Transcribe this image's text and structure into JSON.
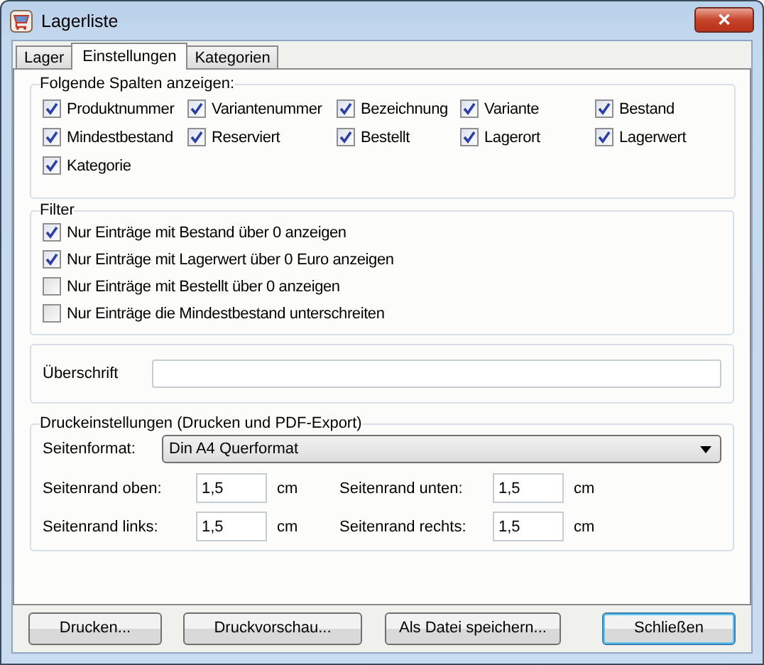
{
  "window": {
    "title": "Lagerliste",
    "close_label": "✕"
  },
  "tabs": [
    {
      "label": "Lager",
      "selected": false
    },
    {
      "label": "Einstellungen",
      "selected": true
    },
    {
      "label": "Kategorien",
      "selected": false
    }
  ],
  "columns_group": {
    "title": "Folgende Spalten anzeigen:",
    "items": [
      {
        "label": "Produktnummer",
        "checked": true
      },
      {
        "label": "Variantenummer",
        "checked": true
      },
      {
        "label": "Bezeichnung",
        "checked": true
      },
      {
        "label": "Variante",
        "checked": true
      },
      {
        "label": "Bestand",
        "checked": true
      },
      {
        "label": "Mindestbestand",
        "checked": true
      },
      {
        "label": "Reserviert",
        "checked": true
      },
      {
        "label": "Bestellt",
        "checked": true
      },
      {
        "label": "Lagerort",
        "checked": true
      },
      {
        "label": "Lagerwert",
        "checked": true
      },
      {
        "label": "Kategorie",
        "checked": true
      }
    ]
  },
  "filter_group": {
    "title": "Filter",
    "items": [
      {
        "label": "Nur Einträge mit Bestand über 0 anzeigen",
        "checked": true
      },
      {
        "label": "Nur Einträge mit Lagerwert über 0 Euro anzeigen",
        "checked": true
      },
      {
        "label": "Nur Einträge mit Bestellt über 0 anzeigen",
        "checked": false
      },
      {
        "label": "Nur Einträge die Mindestbestand unterschreiten",
        "checked": false
      }
    ]
  },
  "heading_field": {
    "label": "Überschrift"
  },
  "print_group": {
    "title": "Druckeinstellungen (Drucken und PDF-Export)",
    "format_label": "Seitenformat:",
    "format_value": "Din A4 Querformat",
    "margins": [
      {
        "label": "Seitenrand oben:",
        "value": "1,5",
        "unit": "cm"
      },
      {
        "label": "Seitenrand unten:",
        "value": "1,5",
        "unit": "cm"
      },
      {
        "label": "Seitenrand links:",
        "value": "1,5",
        "unit": "cm"
      },
      {
        "label": "Seitenrand rechts:",
        "value": "1,5",
        "unit": "cm"
      }
    ]
  },
  "buttons": [
    {
      "label": "Drucken...",
      "default": false
    },
    {
      "label": "Druckvorschau...",
      "default": false
    },
    {
      "label": "Als Datei speichern...",
      "default": false
    },
    {
      "label": "Schließen",
      "default": true
    }
  ]
}
